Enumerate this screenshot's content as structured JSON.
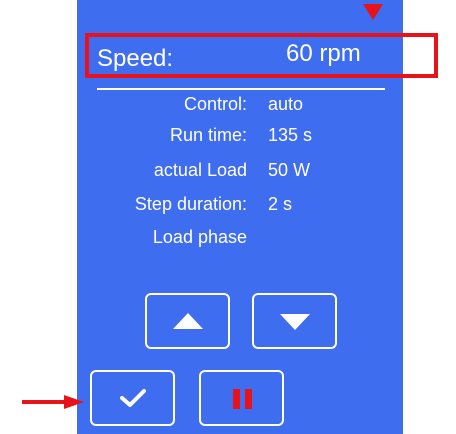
{
  "display": {
    "speed_label": "Speed:",
    "speed_value": "60 rpm",
    "info": [
      {
        "label": "Control:",
        "value": "auto"
      },
      {
        "label": "Run time:",
        "value": "135 s"
      },
      {
        "label": "actual Load",
        "value": "50 W"
      },
      {
        "label": "Step duration:",
        "value": "2 s"
      },
      {
        "label": "Load phase",
        "value": ""
      }
    ]
  },
  "buttons": {
    "up_icon": "triangle-up",
    "down_icon": "triangle-down",
    "confirm_icon": "checkmark",
    "pause_icon": "pause"
  },
  "colors": {
    "panel": "#3f6df0",
    "highlight": "#e8131a",
    "text": "#ffffff",
    "pause": "#e8131a"
  }
}
